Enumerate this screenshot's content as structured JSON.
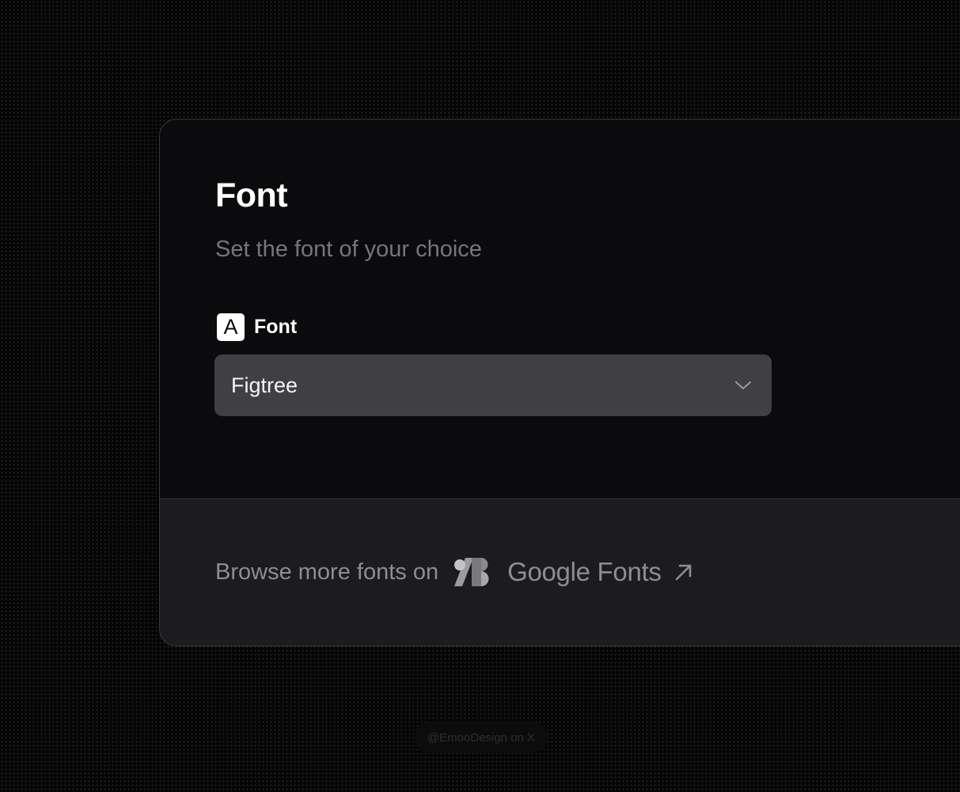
{
  "card": {
    "title": "Font",
    "subtitle": "Set the font of your choice",
    "field": {
      "icon": "letter-a-icon",
      "icon_glyph": "A",
      "label": "Font"
    },
    "select": {
      "value": "Figtree",
      "icon": "chevron-down-icon"
    }
  },
  "footer": {
    "browse_text": "Browse more fonts on",
    "logo_icon": "google-fonts-logo-icon",
    "brand_name": "Google Fonts",
    "link_icon": "external-arrow-icon"
  },
  "credit": "@EmooDesign on X",
  "colors": {
    "background": "#050505",
    "card": "#0b0b0d",
    "footer": "#1c1c1e",
    "select": "#404044",
    "muted_text": "#8d8d92"
  }
}
